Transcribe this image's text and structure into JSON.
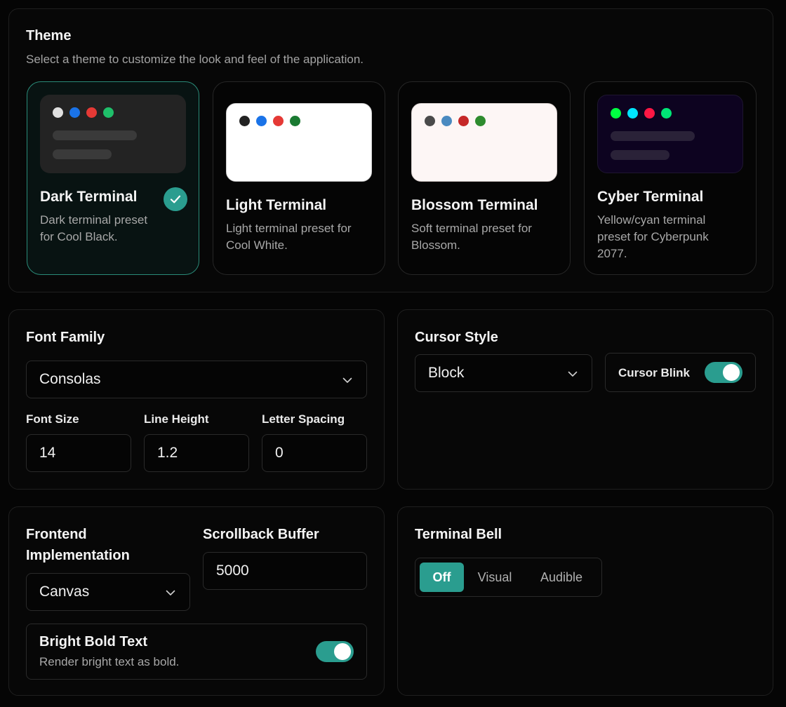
{
  "theme": {
    "title": "Theme",
    "subtitle": "Select a theme to customize the look and feel of the application.",
    "cards": [
      {
        "name": "Dark Terminal",
        "description": "Dark terminal preset for Cool Black.",
        "selected": true,
        "preview_bg": "#232323",
        "dots": [
          "#e0e0e0",
          "#1a73e8",
          "#e53935",
          "#1fbf6a"
        ],
        "bar_color": "#3a3a3a"
      },
      {
        "name": "Light Terminal",
        "description": "Light terminal preset for Cool White.",
        "selected": false,
        "preview_bg": "#ffffff",
        "dots": [
          "#222222",
          "#1a73e8",
          "#e53935",
          "#1a7a32"
        ],
        "bar_color": "#ffffff"
      },
      {
        "name": "Blossom Terminal",
        "description": "Soft terminal preset for Blossom.",
        "selected": false,
        "preview_bg": "#fdf6f5",
        "dots": [
          "#4a4a4a",
          "#4a8ac0",
          "#c62828",
          "#2e8b2e"
        ],
        "bar_color": "#fdf6f5"
      },
      {
        "name": "Cyber Terminal",
        "description": "Yellow/cyan terminal preset for Cyberpunk 2077.",
        "selected": false,
        "preview_bg": "#0d0320",
        "dots": [
          "#00ff41",
          "#00e5ff",
          "#ff1744",
          "#00e676"
        ],
        "bar_color": "#2a2238"
      }
    ]
  },
  "font": {
    "family_label": "Font Family",
    "family_value": "Consolas",
    "size_label": "Font Size",
    "size_value": "14",
    "line_height_label": "Line Height",
    "line_height_value": "1.2",
    "letter_spacing_label": "Letter Spacing",
    "letter_spacing_value": "0"
  },
  "cursor": {
    "style_label": "Cursor Style",
    "style_value": "Block",
    "blink_label": "Cursor Blink",
    "blink_on": true
  },
  "frontend": {
    "impl_label": "Frontend Implementation",
    "impl_value": "Canvas",
    "scrollback_label": "Scrollback Buffer",
    "scrollback_value": "5000",
    "bold_title": "Bright Bold Text",
    "bold_desc": "Render bright text as bold.",
    "bold_on": true
  },
  "bell": {
    "label": "Terminal Bell",
    "options": [
      "Off",
      "Visual",
      "Audible"
    ],
    "selected": "Off"
  },
  "colors": {
    "accent": "#2a9d8f"
  }
}
